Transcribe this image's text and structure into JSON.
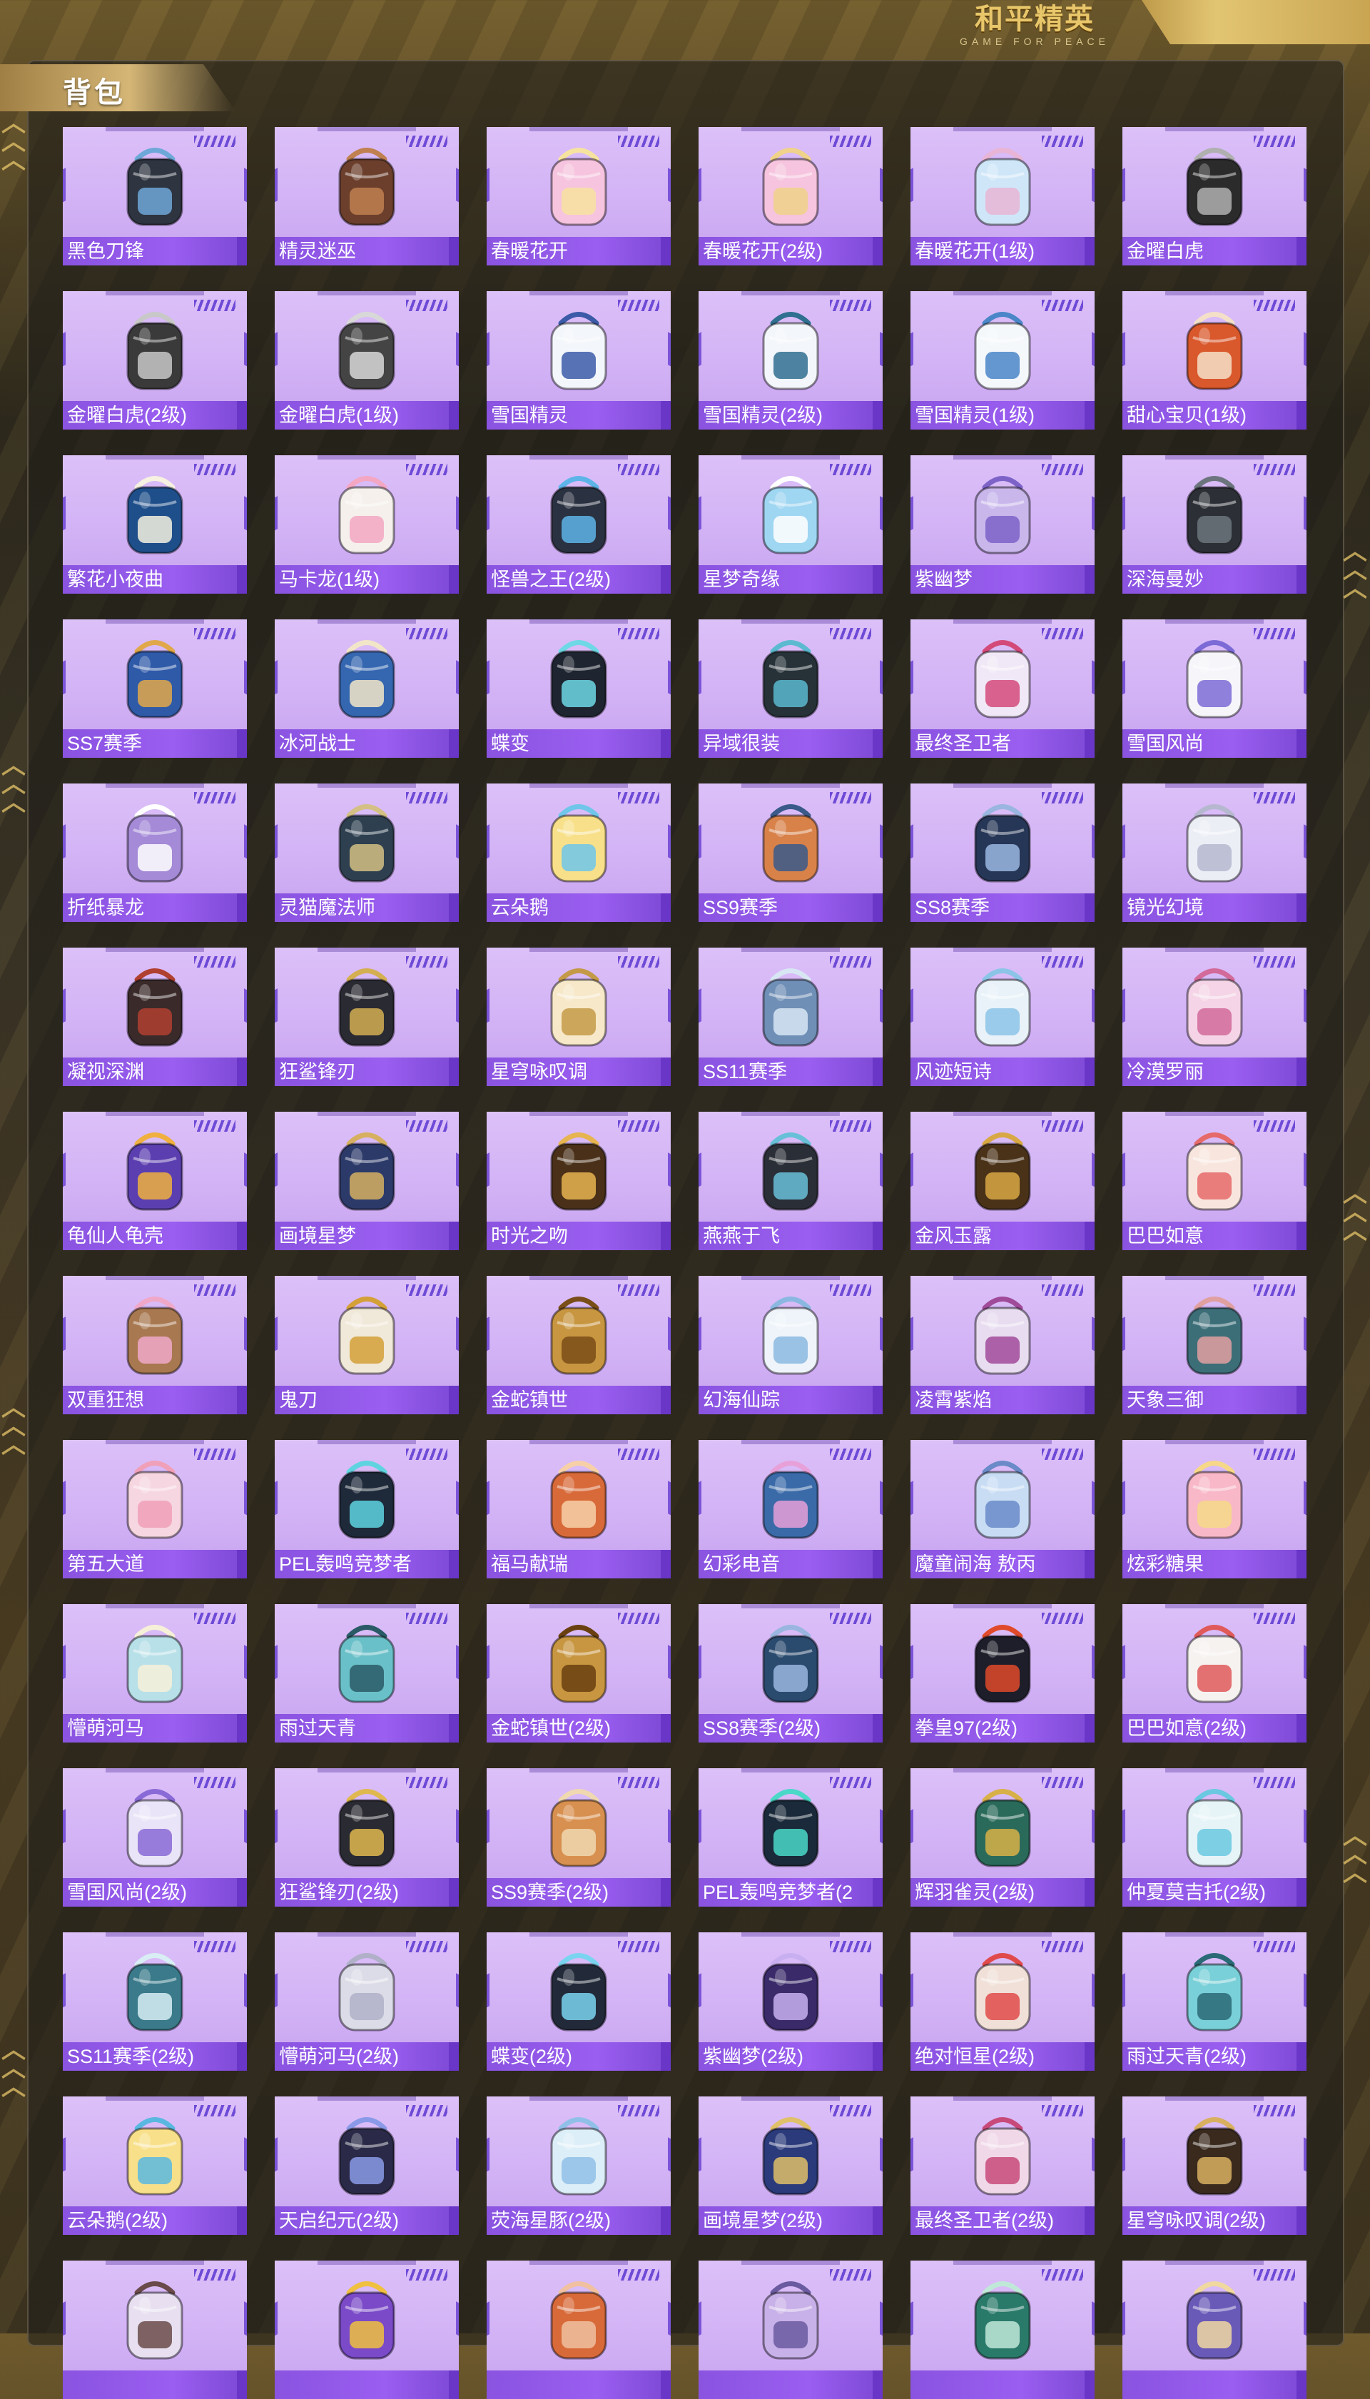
{
  "title": "背包",
  "logo": {
    "main": "和平精英",
    "sub": "GAME FOR PEACE"
  },
  "colors": {
    "card_bg": "#d8bbf7",
    "label_bg": "#8f58e6",
    "accent_gold": "#e2c572"
  },
  "items": [
    {
      "name": "黑色刀锋",
      "color": "#2e3440",
      "accent": "#6ea8d8"
    },
    {
      "name": "精灵迷巫",
      "color": "#6b3f2c",
      "accent": "#c08050"
    },
    {
      "name": "春暖花开",
      "color": "#f6c4de",
      "accent": "#f7e3a0"
    },
    {
      "name": "春暖花开(2级)",
      "color": "#f6c4de",
      "accent": "#f0d28a"
    },
    {
      "name": "春暖花开(1级)",
      "color": "#cfe6f8",
      "accent": "#e8b5d6"
    },
    {
      "name": "金曜白虎",
      "color": "#2b2b2b",
      "accent": "#b0b0b0"
    },
    {
      "name": "金曜白虎(2级)",
      "color": "#3a3a3a",
      "accent": "#c8c8c8"
    },
    {
      "name": "金曜白虎(1级)",
      "color": "#444",
      "accent": "#d8d8d8"
    },
    {
      "name": "雪国精灵",
      "color": "#f3f6fa",
      "accent": "#3b5aa8"
    },
    {
      "name": "雪国精灵(2级)",
      "color": "#f3f6fa",
      "accent": "#2f6f8f"
    },
    {
      "name": "雪国精灵(1级)",
      "color": "#f5f8fb",
      "accent": "#4a86c8"
    },
    {
      "name": "甜心宝贝(1级)",
      "color": "#d9582c",
      "accent": "#f4e0c8"
    },
    {
      "name": "繁花小夜曲",
      "color": "#1f4f8a",
      "accent": "#f6f1e0"
    },
    {
      "name": "马卡龙(1级)",
      "color": "#f5f0ec",
      "accent": "#f3a7c3"
    },
    {
      "name": "怪兽之王(2级)",
      "color": "#2a3140",
      "accent": "#5db4e8"
    },
    {
      "name": "星梦奇缘",
      "color": "#9fd6f2",
      "accent": "#ffffff"
    },
    {
      "name": "紫幽梦",
      "color": "#c9b7ec",
      "accent": "#7d63c8"
    },
    {
      "name": "深海曼妙",
      "color": "#2c3036",
      "accent": "#6c757d"
    },
    {
      "name": "SS7赛季",
      "color": "#2f5aa8",
      "accent": "#e0a84a"
    },
    {
      "name": "冰河战士",
      "color": "#3566b0",
      "accent": "#f2e6c8"
    },
    {
      "name": "蝶变",
      "color": "#1e2430",
      "accent": "#6fd8e6"
    },
    {
      "name": "异域很装",
      "color": "#263238",
      "accent": "#5bbad0"
    },
    {
      "name": "最终圣卫者",
      "color": "#f0e8f6",
      "accent": "#d34a7a"
    },
    {
      "name": "雪国风尚",
      "color": "#f6f6fa",
      "accent": "#7c6bd6"
    },
    {
      "name": "折纸暴龙",
      "color": "#a58ad8",
      "accent": "#ffffff"
    },
    {
      "name": "灵猫魔法师",
      "color": "#2e4050",
      "accent": "#d4c084"
    },
    {
      "name": "云朵鹅",
      "color": "#f8e08a",
      "accent": "#6fc6ea"
    },
    {
      "name": "SS9赛季",
      "color": "#d8824a",
      "accent": "#3a5a8a"
    },
    {
      "name": "SS8赛季",
      "color": "#263656",
      "accent": "#9ab6e0"
    },
    {
      "name": "镜光幻境",
      "color": "#eceef6",
      "accent": "#b6b8d0"
    },
    {
      "name": "凝视深渊",
      "color": "#3a2a2a",
      "accent": "#b04030"
    },
    {
      "name": "狂鲨锋刃",
      "color": "#2a2a32",
      "accent": "#d4af52"
    },
    {
      "name": "星穹咏叹调",
      "color": "#f6e8c8",
      "accent": "#c49a48"
    },
    {
      "name": "SS11赛季",
      "color": "#6f8fb6",
      "accent": "#d8e6f4"
    },
    {
      "name": "风迹短诗",
      "color": "#e8f2f8",
      "accent": "#8cc4e8"
    },
    {
      "name": "冷漠罗丽",
      "color": "#f4d4e6",
      "accent": "#d26a9a"
    },
    {
      "name": "龟仙人龟壳",
      "color": "#5b3fb0",
      "accent": "#f0b040"
    },
    {
      "name": "画境星梦",
      "color": "#2c3a6a",
      "accent": "#d6b060"
    },
    {
      "name": "时光之吻",
      "color": "#4a3018",
      "accent": "#e6b450"
    },
    {
      "name": "燕燕于飞",
      "color": "#2a2e36",
      "accent": "#68c0d8"
    },
    {
      "name": "金风玉露",
      "color": "#4a3218",
      "accent": "#d8a844"
    },
    {
      "name": "巴巴如意",
      "color": "#f8e6de",
      "accent": "#e66a6a"
    },
    {
      "name": "双重狂想",
      "color": "#a87850",
      "accent": "#f0a8c8"
    },
    {
      "name": "鬼刀",
      "color": "#f0e8d8",
      "accent": "#d4a038"
    },
    {
      "name": "金蛇镇世",
      "color": "#c89640",
      "accent": "#7a4e18"
    },
    {
      "name": "幻海仙踪",
      "color": "#eef4fa",
      "accent": "#8ab8e0"
    },
    {
      "name": "凌霄紫焰",
      "color": "#e8dcf0",
      "accent": "#a04a9a"
    },
    {
      "name": "天象三御",
      "color": "#3c6e78",
      "accent": "#e0a0a0"
    },
    {
      "name": "第五大道",
      "color": "#f6d6e0",
      "accent": "#f0a0b8"
    },
    {
      "name": "PEL轰鸣竞梦者",
      "color": "#1e2a3a",
      "accent": "#5fd4e0"
    },
    {
      "name": "福马献瑞",
      "color": "#d86a3a",
      "accent": "#f8d0a8"
    },
    {
      "name": "幻彩电音",
      "color": "#3a6aa8",
      "accent": "#e8a0d8"
    },
    {
      "name": "魔童闹海 敖丙",
      "color": "#c8dcf4",
      "accent": "#6a8ac8"
    },
    {
      "name": "炫彩糖果",
      "color": "#f8b8c8",
      "accent": "#f6d888"
    },
    {
      "name": "懵萌河马",
      "color": "#b8e0e8",
      "accent": "#f6f0d8"
    },
    {
      "name": "雨过天青",
      "color": "#6ac0c8",
      "accent": "#2a5a66"
    },
    {
      "name": "金蛇镇世(2级)",
      "color": "#c89640",
      "accent": "#6a4010"
    },
    {
      "name": "SS8赛季(2级)",
      "color": "#2a4a6e",
      "accent": "#9ab6e0"
    },
    {
      "name": "拳皇97(2级)",
      "color": "#1e1e2a",
      "accent": "#e04a2a"
    },
    {
      "name": "巴巴如意(2级)",
      "color": "#f6f2f0",
      "accent": "#e05a5a"
    },
    {
      "name": "雪国风尚(2级)",
      "color": "#eae4f8",
      "accent": "#8a6ad6"
    },
    {
      "name": "狂鲨锋刃(2级)",
      "color": "#2a2a32",
      "accent": "#e0b850"
    },
    {
      "name": "SS9赛季(2级)",
      "color": "#d89050",
      "accent": "#f0d8b0"
    },
    {
      "name": "PEL轰鸣竞梦者(2",
      "color": "#1a2a3a",
      "accent": "#4ad8c8"
    },
    {
      "name": "辉羽雀灵(2级)",
      "color": "#2a6a5a",
      "accent": "#d8b048"
    },
    {
      "name": "仲夏莫吉托(2级)",
      "color": "#e6f4f8",
      "accent": "#6ac8e0"
    },
    {
      "name": "SS11赛季(2级)",
      "color": "#3a7a8a",
      "accent": "#d8eef4"
    },
    {
      "name": "懵萌河马(2级)",
      "color": "#dcdce8",
      "accent": "#b0b0c8"
    },
    {
      "name": "蝶变(2级)",
      "color": "#222a3a",
      "accent": "#7ad4f0"
    },
    {
      "name": "紫幽梦(2级)",
      "color": "#3a2a6a",
      "accent": "#c8b0f0"
    },
    {
      "name": "绝对恒星(2级)",
      "color": "#f0e0d8",
      "accent": "#e04a4a"
    },
    {
      "name": "雨过天青(2级)",
      "color": "#7ad0d8",
      "accent": "#2a6a76"
    },
    {
      "name": "云朵鹅(2级)",
      "color": "#f8e08a",
      "accent": "#5ab8e0"
    },
    {
      "name": "天启纪元(2级)",
      "color": "#2a2a48",
      "accent": "#8a9ae8"
    },
    {
      "name": "荧海星豚(2级)",
      "color": "#dceef8",
      "accent": "#90c0e8"
    },
    {
      "name": "画境星梦(2级)",
      "color": "#2a3a7a",
      "accent": "#e0c068"
    },
    {
      "name": "最终圣卫者(2级)",
      "color": "#f0d8e8",
      "accent": "#c84a7a"
    },
    {
      "name": "星穹咏叹调(2级)",
      "color": "#3a2a1e",
      "accent": "#d8b060"
    },
    {
      "name": "",
      "color": "#e8e0f0",
      "accent": "#6a4a4a"
    },
    {
      "name": "",
      "color": "#7a4ac8",
      "accent": "#f0c040"
    },
    {
      "name": "",
      "color": "#d86a3a",
      "accent": "#f0c0a0"
    },
    {
      "name": "",
      "color": "#c8b0e8",
      "accent": "#6a5aa0"
    },
    {
      "name": "",
      "color": "#2a7a6a",
      "accent": "#c0e8d8"
    },
    {
      "name": "",
      "color": "#6a5ab8",
      "accent": "#f0d8a0"
    }
  ]
}
